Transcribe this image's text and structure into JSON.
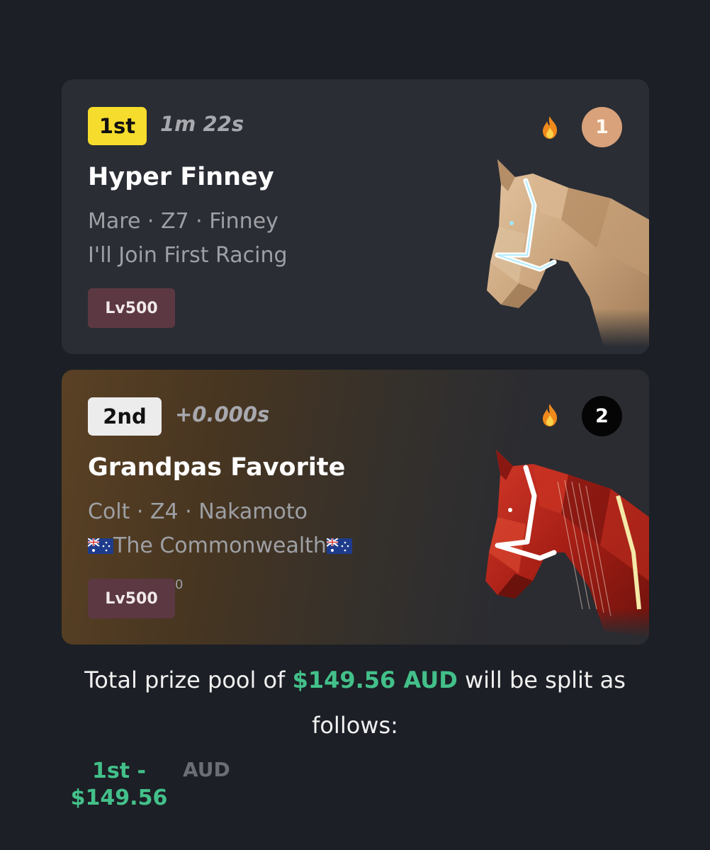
{
  "results": [
    {
      "place": "1st",
      "time": "1m 22s",
      "name": "Hyper Finney",
      "details": "Mare · Z7 · Finney",
      "stable": "I'll Join First Racing",
      "level": "Lv500",
      "gate": "1",
      "gate_color": "#d9a27b",
      "place_color": "#f6dc2c",
      "horse_color": "#d2ae86",
      "icons": [
        "fire-icon",
        "horse-image"
      ]
    },
    {
      "place": "2nd",
      "time": "+0.000s",
      "name": "Grandpas Favorite",
      "details": "Colt · Z4 · Nakamoto",
      "stable": "The Commonwealth",
      "stable_flags": [
        "australia-flag-icon",
        "australia-flag-icon"
      ],
      "level": "Lv500",
      "stray_text": "0",
      "gate": "2",
      "gate_color": "#050505",
      "place_color": "#ececec",
      "horse_color": "#b3241a",
      "icons": [
        "fire-icon",
        "horse-image"
      ]
    }
  ],
  "prize": {
    "prefix": "Total prize pool of ",
    "amount": "$149.56 AUD",
    "suffix": " will be split as follows:",
    "accent_color": "#43c08a"
  },
  "split": [
    {
      "place_label": "1st -",
      "amount": "$149.56",
      "currency": "AUD"
    }
  ]
}
